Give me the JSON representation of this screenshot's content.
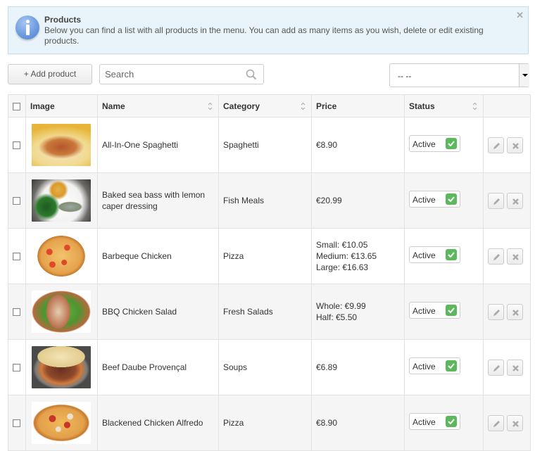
{
  "alert": {
    "icon": "info-icon",
    "title": "Products",
    "text": "Below you can find a list with all products in the menu. You can add as many items as you wish, delete or edit existing products.",
    "close_icon": "close-icon"
  },
  "toolbar": {
    "add_label": "+ Add product",
    "search_placeholder": "Search",
    "search_value": "",
    "filter_selected": "-- --"
  },
  "table": {
    "columns": [
      "Image",
      "Name",
      "Category",
      "Price",
      "Status"
    ],
    "sortable": [
      "Name",
      "Category",
      "Status"
    ],
    "rows": [
      {
        "name": "All-In-One Spaghetti",
        "category": "Spaghetti",
        "price": [
          "€8.90"
        ],
        "status": "Active",
        "image": "spaghetti"
      },
      {
        "name": "Baked sea bass with lemon caper dressing",
        "category": "Fish Meals",
        "price": [
          "€20.99"
        ],
        "status": "Active",
        "image": "sea-bass"
      },
      {
        "name": "Barbeque Chicken",
        "category": "Pizza",
        "price": [
          "Small: €10.05",
          "Medium: €13.65",
          "Large: €16.63"
        ],
        "status": "Active",
        "image": "pizza-bbq"
      },
      {
        "name": "BBQ Chicken Salad",
        "category": "Fresh Salads",
        "price": [
          "Whole: €9.99",
          "Half: €5.50"
        ],
        "status": "Active",
        "image": "salad"
      },
      {
        "name": "Beef Daube Provençal",
        "category": "Soups",
        "price": [
          "€6.89"
        ],
        "status": "Active",
        "image": "beef-stew"
      },
      {
        "name": "Blackened Chicken Alfredo",
        "category": "Pizza",
        "price": [
          "€8.90"
        ],
        "status": "Active",
        "image": "pizza-mushroom"
      }
    ]
  },
  "colors": {
    "alert_bg": "#e8f4f9",
    "alert_border": "#bfe0ec",
    "status_active": "#5cb85c",
    "info_blue": "#6f9ce0"
  }
}
